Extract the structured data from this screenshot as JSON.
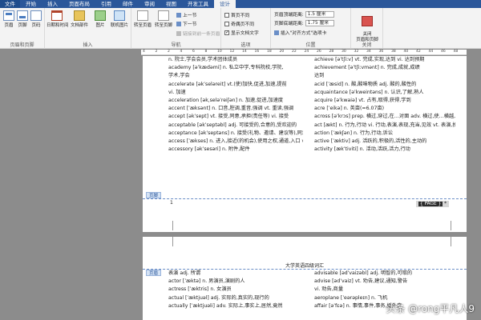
{
  "tabs": [
    "文件",
    "开始",
    "插入",
    "页面布局",
    "引用",
    "邮件",
    "审阅",
    "视图",
    "开发工具",
    "设计"
  ],
  "groups": {
    "header_footer": {
      "label": "页眉和页脚",
      "header": "页眉",
      "footer": "页脚",
      "page_number": "页码"
    },
    "insert": {
      "label": "插入",
      "date_time": "日期和时间",
      "doc_parts": "文档部件",
      "picture": "图片",
      "online_picture": "联机图片"
    },
    "navigation": {
      "label": "导航",
      "goto_header": "转至页眉",
      "goto_footer": "转至页脚",
      "previous": "上一节",
      "next": "下一节",
      "link_previous": "链接到前一条页眉"
    },
    "options": {
      "label": "选项",
      "different_first": "首页不同",
      "different_odd_even": "奇偶页不同",
      "show_doc_text": "显示文档文字"
    },
    "position": {
      "label": "位置",
      "header_from_top": "页眉顶端距离:",
      "footer_from_bottom": "页脚底端距离:",
      "insert_align_tab": "插入\"对齐方式\"选项卡",
      "header_value": "1.5 厘米",
      "footer_value": "1.75 厘米"
    },
    "close": {
      "label": "关闭",
      "close_button": "关闭\n页眉和页脚"
    }
  },
  "ruler": [
    "4",
    "2",
    "2",
    "4",
    "6",
    "8",
    "10",
    "12",
    "14",
    "16",
    "18",
    "20",
    "22",
    "24",
    "26",
    "28",
    "30",
    "32",
    "34",
    "36",
    "38",
    "40",
    "42",
    "44",
    "46",
    "48"
  ],
  "page1": {
    "col1": [
      "n. 院士,学会会员,学术团体成员",
      "academy [əˈkædəmi]  n. 私立中学,专科院校,学院,",
      "学术,学会",
      "accelerate [əkˈseləreit]  vt.(使)加快,促进,加速,提前",
      "vi. 加速",
      "acceleration [əkˌseləˈreiʃən]  n. 加速,促进,加速度",
      "accent [ˈæksənt]  n. 口音,腔调,重音,强调  vt. 重读,强调",
      "accept [əkˈsept]  vt. 接受,同意,承担(责任等)  vi. 接受",
      "acceptable [əkˈseptəbl]  adj. 可接受的,合意的,受欢迎的",
      "acceptance [əkˈseptəns]  n. 接受(礼物、邀请、建议等),同意,认可,验收,承认",
      "access [ˈækses]  n. 进入,接近(的机会),使用之权,通道,入口  vt. (电脑)存取,进入",
      "accessory [əkˈsesəri]  n. 附件,配件"
    ],
    "col2": [
      "achieve [əˈtʃiːv]  vt. 完成,实现,达到  vi. 达到预期",
      "achievement [əˈtʃiːvmənt]  n. 完成,成就,成绩",
      "达到",
      "acid [ˈæsid]  n. 酸,酸味物质  adj. 酸的,酸性的",
      "acquaintance [əˈkweintəns]  n. 认识,了解,熟人",
      "acquire [əˈkwaiə]  vt. 占有,取得,获得,学到",
      "acre [ˈeikə]  n. 英亩(=6.07亩)",
      "across [əˈkrɔs]  prep. 横过,穿过,在…对面  adv. 横过,使…横越,横穿",
      "act [ækt]  n. 行为,行动  vi. 行动,表演,表现,充当,见效  vt. 表演,扮演",
      "action [ˈækʃən]  n. 行为,行动,诉讼",
      "active [ˈæktiv]  adj. 活跃的,积极的,活性的,主动的",
      "activity [ækˈtiviti]  n. 活动,活跃,活力,行动"
    ],
    "footer_tag": "页脚",
    "footer_num": "1",
    "footer_field_pre": "{ PAGE }",
    "footer_field_post": "*"
  },
  "page2": {
    "title": "大学英语四级词汇",
    "header_tag": "页眉",
    "col1": [
      "表演  adj. 所谓",
      "actor [ˈæktə]  n. 男演员,演剧的人",
      "actress [ˈæktris]  n. 女演员",
      "actual [ˈæktjuəl]  adj. 实际的,真实的,现行的",
      "actually [ˈæktjuəli]  adv. 实际上,事实上,居然,竟然"
    ],
    "col2": [
      "advisable [ədˈvaizəbl]  adj. 明智的,可取的",
      "advise [ədˈvaiz]  vt. 劝告,建议,通知,警告",
      "vi. 劝告,商量",
      "aeroplane [ˈeərəpleɪn]  n. 飞机",
      "affair [əˈfɛə]  n. 事情,事件,事务,婚外恋"
    ]
  },
  "watermark": "头条 @rong平凡人9"
}
